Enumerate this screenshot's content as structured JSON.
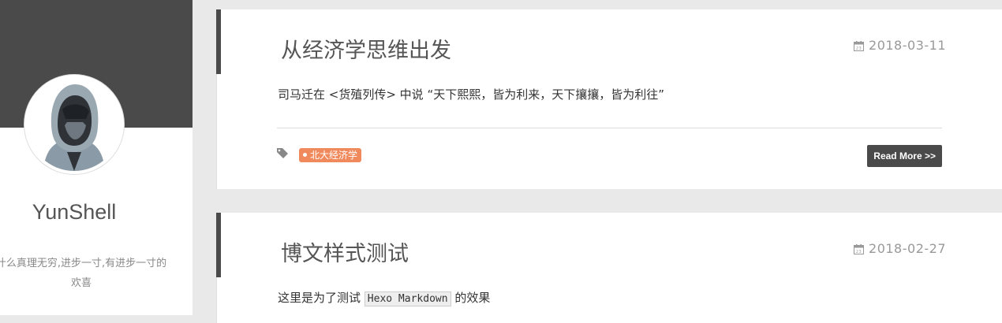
{
  "sidebar": {
    "site_name": "YunShell",
    "motto": "什么真理无穷,进步一寸,有进步一寸的欢喜"
  },
  "posts": [
    {
      "title": "从经济学思维出发",
      "date": "2018-03-11",
      "excerpt": "司马迁在 <货殖列传> 中说 “天下熙熙，皆为利来，天下攘攘，皆为利往”",
      "tag": "北大经济学",
      "read_more": "Read More >>"
    },
    {
      "title": "博文样式测试",
      "date": "2018-02-27",
      "excerpt_before": "这里是为了测试",
      "excerpt_code": "Hexo Markdown",
      "excerpt_after": " 的效果"
    }
  ],
  "colors": {
    "sidebar_cover": "#4a4a4a",
    "tag": "#f08a5d",
    "button": "#4a4a4a",
    "page_bg": "#e9e9e9"
  },
  "icons": [
    "calendar-icon",
    "tag-icon"
  ]
}
